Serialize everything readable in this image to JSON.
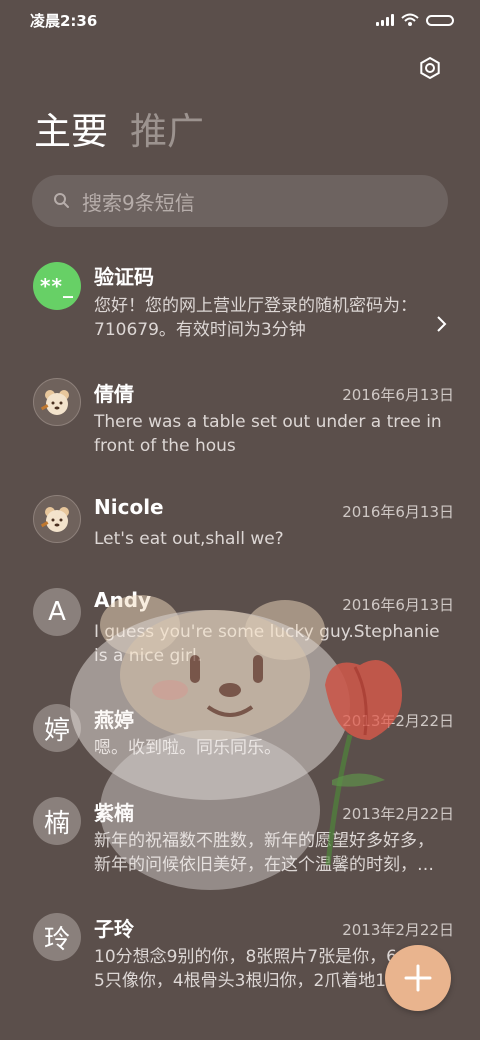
{
  "status_bar": {
    "time": "凌晨2:36"
  },
  "tabs": [
    {
      "label": "主要",
      "active": true
    },
    {
      "label": "推广",
      "active": false
    }
  ],
  "search": {
    "placeholder": "搜索9条短信"
  },
  "colors": {
    "background": "#5b4f4b",
    "fab": "#e9b48e",
    "verification_avatar": "#67d066"
  },
  "messages": [
    {
      "name": "验证码",
      "avatar_text": "**_",
      "date": "",
      "preview": "您好！您的网上营业厅登录的随机密码为：710679。有效时间为3分钟"
    },
    {
      "name": "倩倩",
      "avatar_icon": "bear-avatar-icon",
      "date": "2016年6月13日",
      "preview": "There was a table set out under a tree in front of the hous"
    },
    {
      "name": "Nicole",
      "avatar_icon": "bear-avatar-icon",
      "date": "2016年6月13日",
      "preview": "Let's eat out,shall we?"
    },
    {
      "name": "Andy",
      "avatar_text": "A",
      "date": "2016年6月13日",
      "preview": "I guess you're some lucky guy.Stephanie is a nice girl."
    },
    {
      "name": "燕婷",
      "avatar_text": "婷",
      "date": "2013年2月22日",
      "preview": "嗯。收到啦。同乐同乐。"
    },
    {
      "name": "紫楠",
      "avatar_text": "楠",
      "date": "2013年2月22日",
      "preview": "新年的祝福数不胜数，新年的愿望好多好多，\n新年的问候依旧美好，在这个温馨的时刻，…"
    },
    {
      "name": "子玲",
      "avatar_text": "玲",
      "date": "2013年2月22日",
      "preview": "10分想念9别的你，8张照片7张是你，6\n5只像你，4根骨头3根归你，2爪着地1"
    }
  ],
  "fab": {
    "label": "+"
  }
}
